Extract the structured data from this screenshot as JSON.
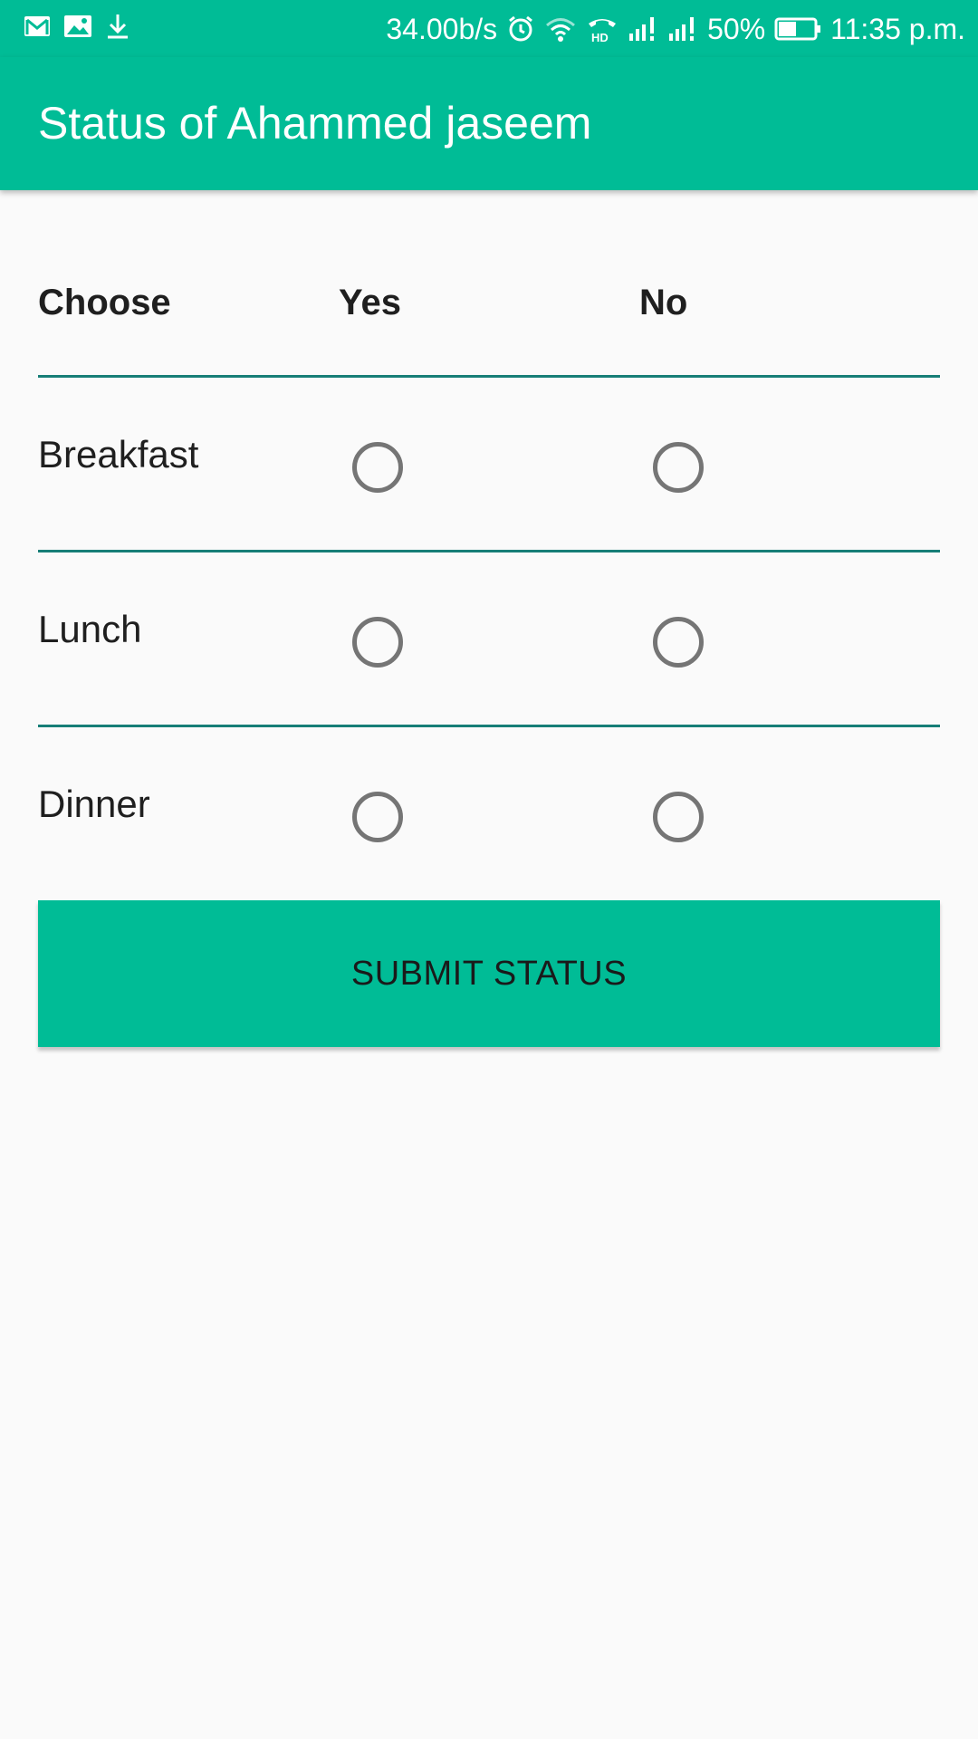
{
  "status_bar": {
    "left_icons": [
      "gmail-icon",
      "image-icon",
      "download-icon"
    ],
    "net_speed": "34.00b/s",
    "battery_percent": "50%",
    "time": "11:35 p.m.",
    "battery_level": 0.5
  },
  "app_bar": {
    "title": "Status of Ahammed jaseem"
  },
  "table": {
    "headers": [
      "Choose",
      "Yes",
      "No"
    ],
    "rows": [
      {
        "label": "Breakfast",
        "yes_selected": false,
        "no_selected": false
      },
      {
        "label": "Lunch",
        "yes_selected": false,
        "no_selected": false
      },
      {
        "label": "Dinner",
        "yes_selected": false,
        "no_selected": false
      }
    ]
  },
  "submit_label": "SUBMIT STATUS",
  "colors": {
    "primary": "#00bc96",
    "divider": "#177e77",
    "radio_outline": "#757575",
    "background": "#fafafa"
  }
}
